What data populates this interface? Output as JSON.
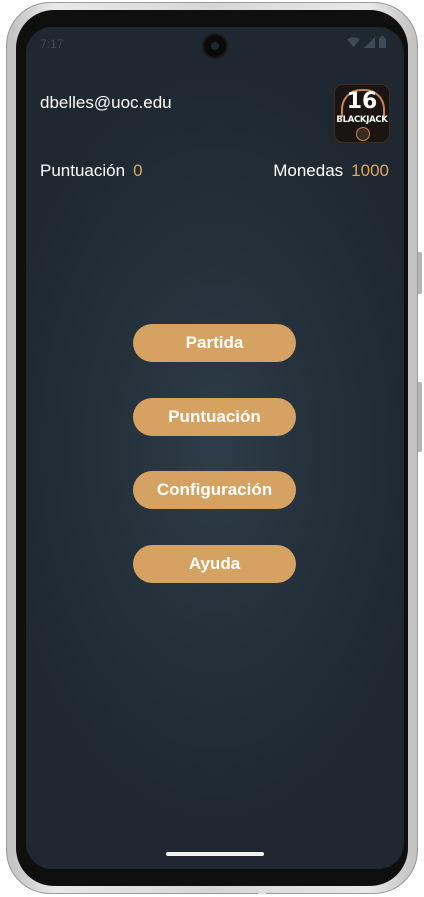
{
  "status_bar": {
    "time": "7:17"
  },
  "header": {
    "email": "dbelles@uoc.edu",
    "logo": {
      "number": "16",
      "text": "BLACKJACK"
    }
  },
  "stats": {
    "score_label": "Puntuación",
    "score_value": "0",
    "coins_label": "Monedas",
    "coins_value": "1000"
  },
  "menu": {
    "buttons": [
      {
        "label": "Partida"
      },
      {
        "label": "Puntuación"
      },
      {
        "label": "Configuración"
      },
      {
        "label": "Ayuda"
      }
    ]
  },
  "colors": {
    "background": "#25313b",
    "accent": "#d5a261",
    "value_text": "#d9a665",
    "text": "#ffffff"
  },
  "icons": [
    "wifi-icon",
    "cellular-signal-icon",
    "battery-icon"
  ]
}
